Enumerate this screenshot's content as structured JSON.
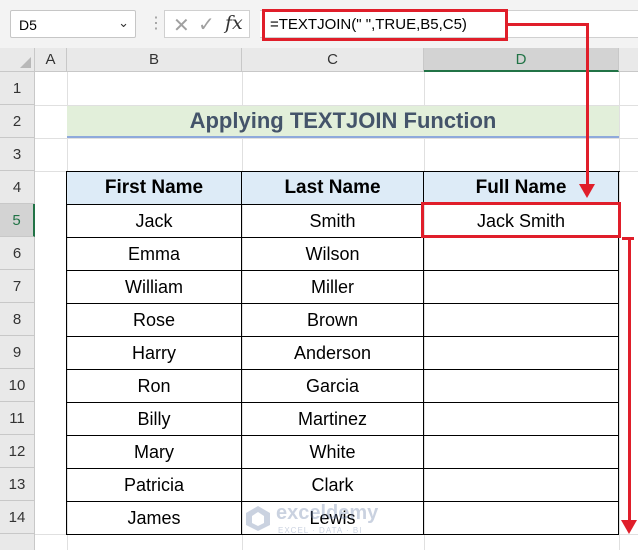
{
  "name_box": "D5",
  "formula": "=TEXTJOIN(\" \",TRUE,B5,C5)",
  "columns": [
    "A",
    "B",
    "C",
    "D"
  ],
  "rows": [
    "1",
    "2",
    "3",
    "4",
    "5",
    "6",
    "7",
    "8",
    "9",
    "10",
    "11",
    "12",
    "13",
    "14"
  ],
  "title": "Applying TEXTJOIN Function",
  "table": {
    "headers": [
      "First Name",
      "Last Name",
      "Full Name"
    ],
    "rows": [
      [
        "Jack",
        "Smith",
        "Jack Smith"
      ],
      [
        "Emma",
        "Wilson",
        ""
      ],
      [
        "William",
        "Miller",
        ""
      ],
      [
        "Rose",
        "Brown",
        ""
      ],
      [
        "Harry",
        "Anderson",
        ""
      ],
      [
        "Ron",
        "Garcia",
        ""
      ],
      [
        "Billy",
        "Martinez",
        ""
      ],
      [
        "Mary",
        "White",
        ""
      ],
      [
        "Patricia",
        "Clark",
        ""
      ],
      [
        "James",
        "Lewis",
        ""
      ]
    ]
  },
  "watermark": {
    "name": "exceldemy",
    "tagline": "EXCEL · DATA · BI"
  },
  "colors": {
    "highlight": "#e01e2a",
    "title_bg": "#e2efda",
    "header_bg": "#ddebf7",
    "excel_green": "#217346"
  }
}
